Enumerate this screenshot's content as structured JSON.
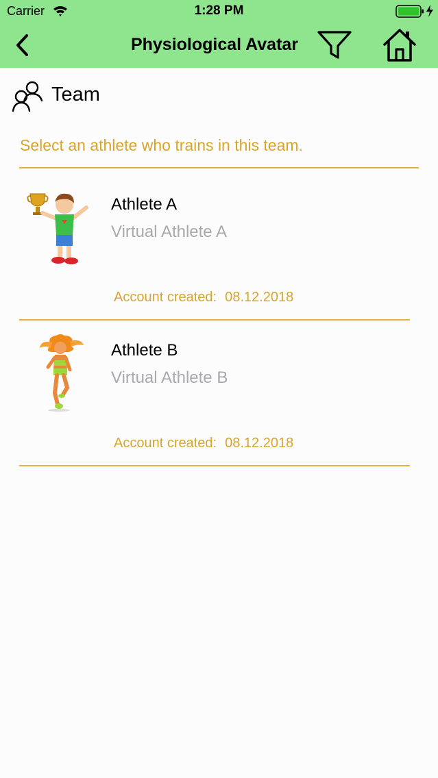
{
  "status_bar": {
    "carrier": "Carrier",
    "time": "1:28 PM",
    "wifi_icon": "wifi-icon",
    "battery_icon": "battery-icon",
    "charging_icon": "charging-bolt-icon"
  },
  "nav": {
    "title": "Physiological Avatar",
    "back_icon": "chevron-left-icon",
    "filter_icon": "filter-icon",
    "home_icon": "home-icon",
    "background": "#8ee58d"
  },
  "section": {
    "icon": "team-icon",
    "label": "Team"
  },
  "prompt": "Select an athlete who trains in this team.",
  "athletes": [
    {
      "name": "Athlete A",
      "subtitle": "Virtual Athlete A",
      "created_label": "Account created:",
      "created_date": "08.12.2018",
      "avatar": "boy-with-trophy-avatar"
    },
    {
      "name": "Athlete B",
      "subtitle": "Virtual Athlete B",
      "created_label": "Account created:",
      "created_date": "08.12.2018",
      "avatar": "girl-runner-avatar"
    }
  ],
  "colors": {
    "accent": "#d8a52a",
    "divider": "#e3b23c",
    "muted": "#a9a9ae"
  }
}
